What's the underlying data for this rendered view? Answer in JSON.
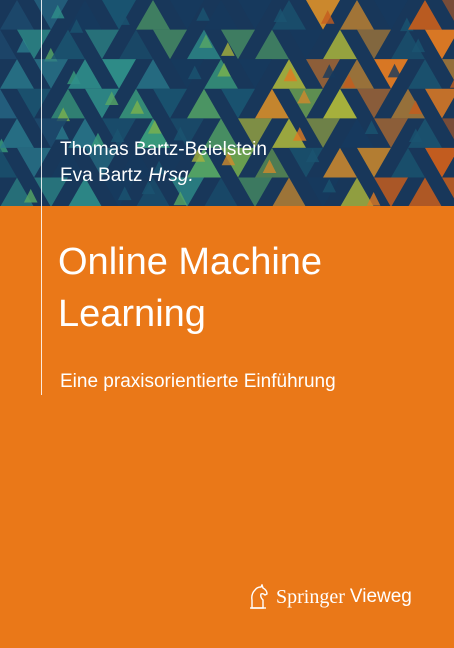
{
  "cover": {
    "authors": [
      "Thomas Bartz-Beielstein",
      "Eva Bartz"
    ],
    "editor_tag": "Hrsg.",
    "title_lines": [
      "Online Machine",
      "Learning"
    ],
    "subtitle": "Eine praxisorientierte Einführung",
    "publisher": {
      "brand": "Springer",
      "imprint": "Vieweg"
    },
    "colors": {
      "band": "#18375a",
      "orange": "#ea7818",
      "text": "#ffffff"
    }
  }
}
